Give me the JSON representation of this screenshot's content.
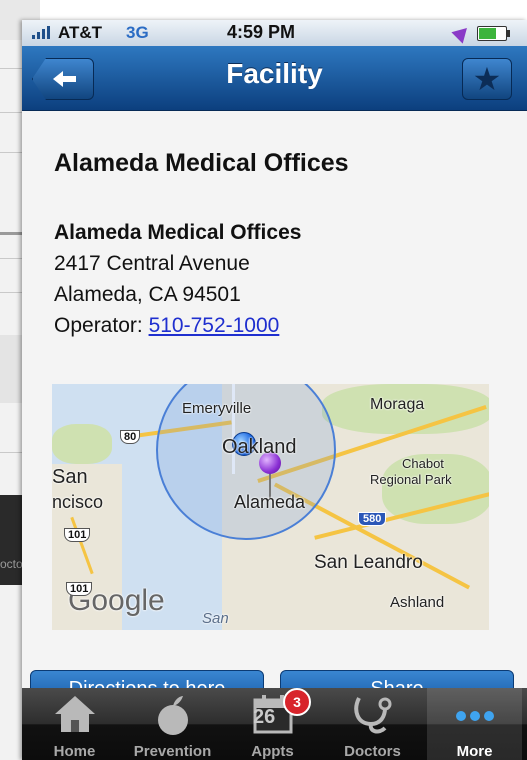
{
  "background": {
    "partial_label": "octor"
  },
  "status_bar": {
    "carrier": "AT&T",
    "network": "3G",
    "time": "4:59 PM"
  },
  "nav": {
    "title": "Facility"
  },
  "facility": {
    "heading": "Alameda Medical Offices",
    "name": "Alameda Medical Offices",
    "street": "2417 Central Avenue",
    "city_line": "Alameda, CA 94501",
    "operator_label": "Operator:",
    "operator_phone": "510-752-1000"
  },
  "map": {
    "labels": {
      "emeryville": "Emeryville",
      "oakland": "Oakland",
      "moraga": "Moraga",
      "san": "San",
      "ncisco": "ncisco",
      "alameda": "Alameda",
      "chabot": "Chabot",
      "regional_park": "Regional Park",
      "san_leandro": "San Leandro",
      "ashland": "Ashland",
      "san_bottom": "San",
      "google": "Google"
    },
    "shields": {
      "i80": "80",
      "i580": "580",
      "us101a": "101",
      "us101b": "101"
    }
  },
  "actions": {
    "directions": "Directions to here",
    "share": "Share"
  },
  "tabs": [
    {
      "label": "Home",
      "icon": "home-icon"
    },
    {
      "label": "Prevention",
      "icon": "apple-icon"
    },
    {
      "label": "Appts",
      "icon": "calendar-icon",
      "badge": "3",
      "calendar_day": "26"
    },
    {
      "label": "Doctors",
      "icon": "stethoscope-icon"
    },
    {
      "label": "More",
      "icon": "more-icon",
      "active": true
    }
  ]
}
